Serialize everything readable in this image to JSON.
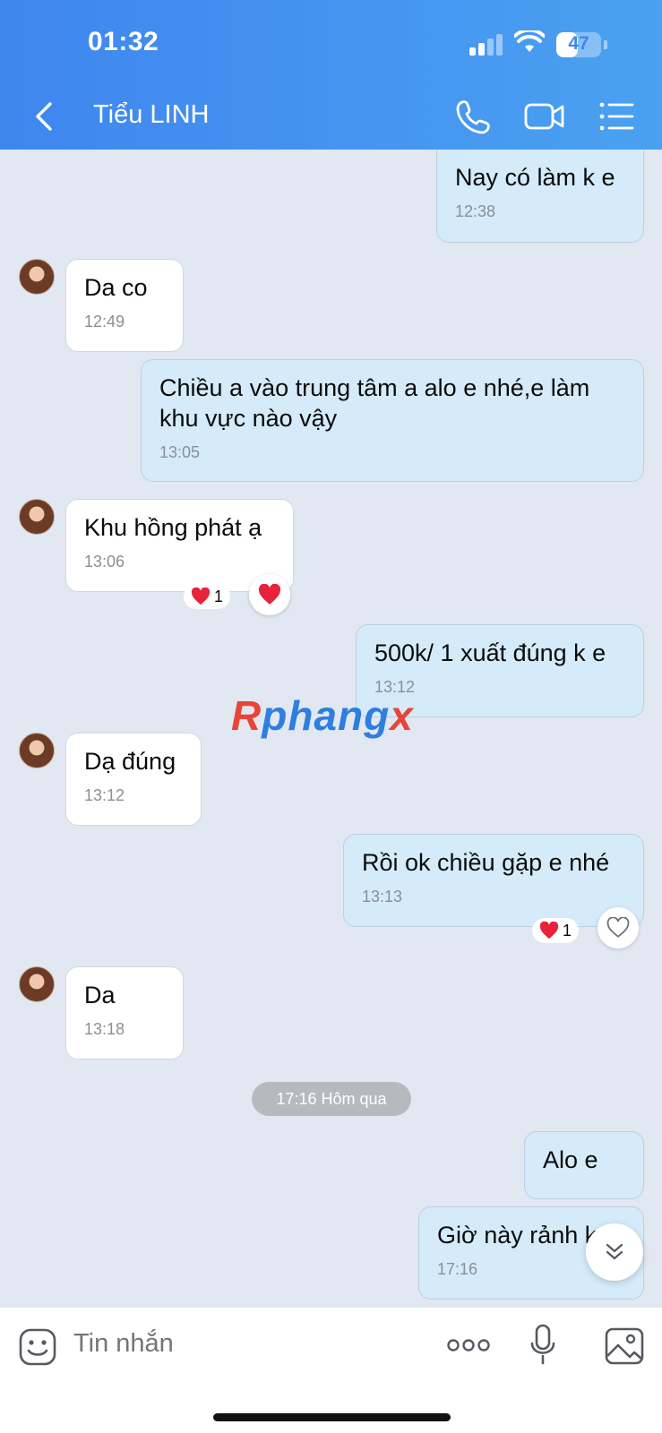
{
  "status_bar": {
    "time": "01:32",
    "battery": "47",
    "battery_level": 0.47
  },
  "header": {
    "contact_name": "Tiểu LINH"
  },
  "messages": [
    {
      "text": "Nay có làm k e",
      "time": "12:38"
    },
    {
      "text": "Da co",
      "time": "12:49"
    },
    {
      "text": "Chiều a vào trung tâm a alo e nhé,e làm khu vực nào vậy",
      "time": "13:05"
    },
    {
      "text": "Khu hồng phát ạ",
      "time": "13:06",
      "reaction_count": "1"
    },
    {
      "text": "500k/ 1 xuất đúng k e",
      "time": "13:12"
    },
    {
      "text": "Dạ đúng",
      "time": "13:12"
    },
    {
      "text": "Rồi ok chiều gặp e nhé",
      "time": "13:13",
      "reaction_count": "1"
    },
    {
      "text": "Da",
      "time": "13:18"
    },
    {
      "text": "Alo e"
    },
    {
      "text": "Giờ này rảnh k",
      "time": "17:16"
    }
  ],
  "divider": {
    "label": "17:16 Hôm qua"
  },
  "watermark": {
    "part1": "R",
    "part2": "phang",
    "part3": "x"
  },
  "composer": {
    "placeholder": "Tin nhắn"
  },
  "colors": {
    "header_start": "#3f86ef",
    "header_end": "#4aa1f0",
    "outgoing_bubble": "#d5ebfa",
    "incoming_bubble": "#ffffff",
    "chat_bg": "#e2e8f1",
    "heart": "#e8223b"
  },
  "icons": [
    "back-chevron-icon",
    "phone-icon",
    "video-camera-icon",
    "menu-list-icon",
    "heart-icon",
    "chevron-double-down-icon",
    "sticker-face-icon",
    "more-dots-icon",
    "microphone-icon",
    "image-icon"
  ]
}
